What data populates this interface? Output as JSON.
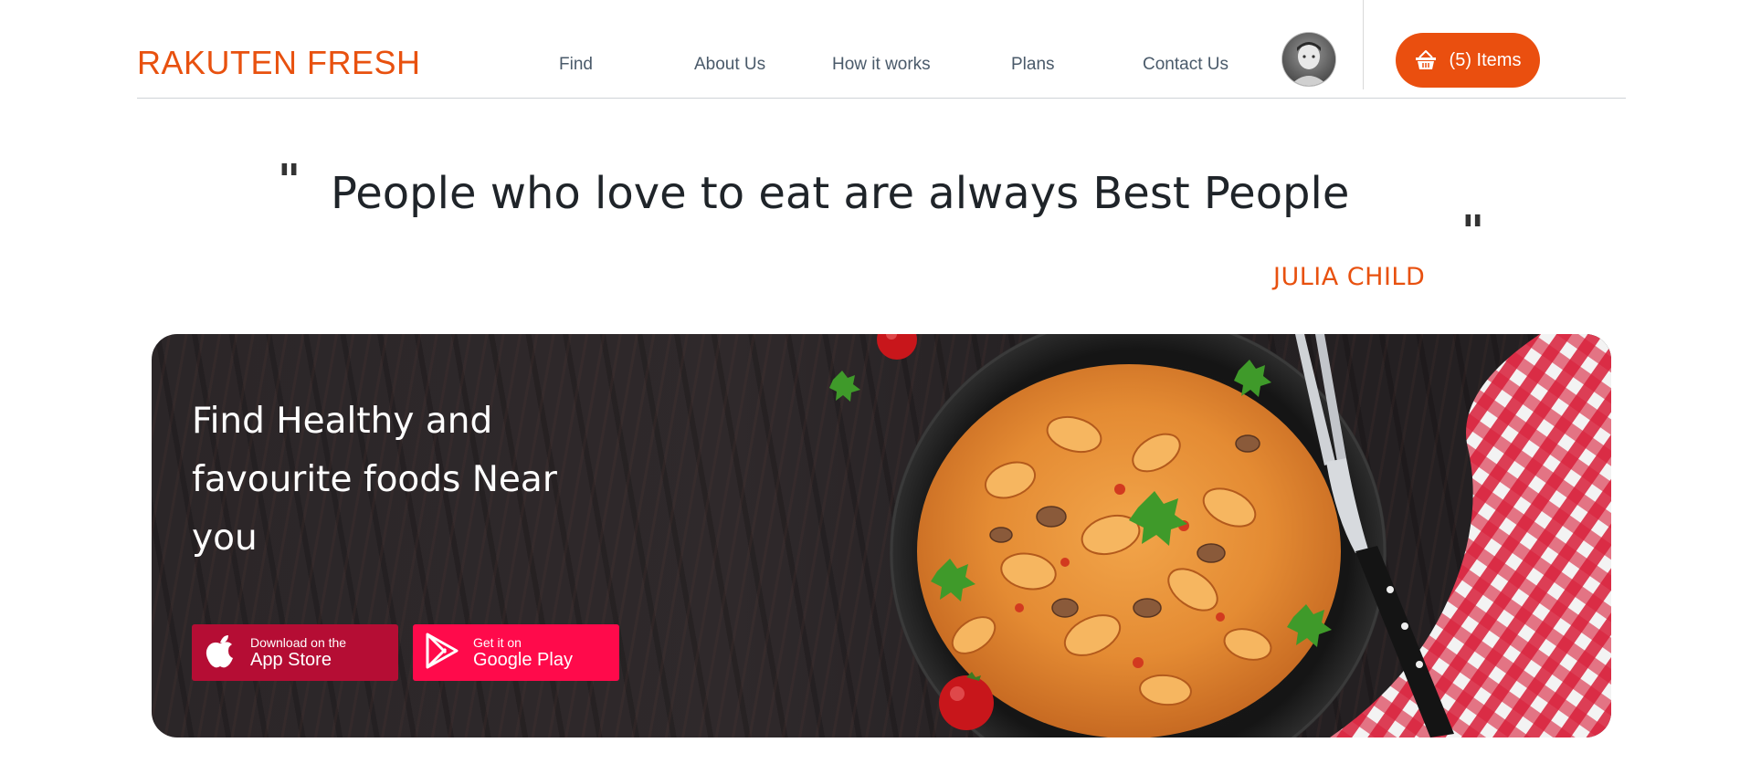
{
  "header": {
    "brand": "RAKUTEN FRESH",
    "nav": [
      {
        "label": "Find"
      },
      {
        "label": "About Us"
      },
      {
        "label": "How it works"
      },
      {
        "label": "Plans"
      },
      {
        "label": "Contact Us"
      }
    ],
    "cart_label": "(5) Items",
    "cart_icon": "basket-icon",
    "avatar_icon": "user-avatar"
  },
  "quote": {
    "open_mark": "\"",
    "text": "People who love to eat are always Best People",
    "close_mark": "\"",
    "author": "JULIA CHILD"
  },
  "hero": {
    "title": "Find Healthy and favourite foods Near you",
    "app_store": {
      "small": "Download on the",
      "big": "App Store",
      "icon": "apple-icon"
    },
    "google_play": {
      "small": "Get it on",
      "big": "Google Play",
      "icon": "play-icon"
    }
  },
  "colors": {
    "brand": "#e8510f",
    "app_store_button": "#b50d34",
    "google_play_button": "#ff0a4b"
  }
}
